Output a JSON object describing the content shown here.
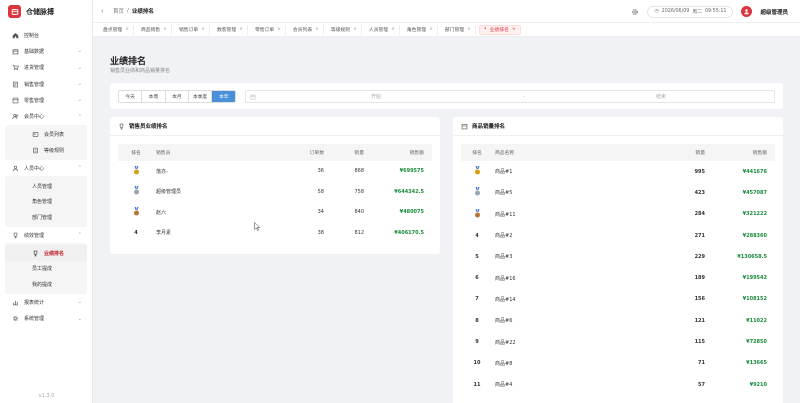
{
  "app": {
    "title": "仓储脉搏",
    "version": "v1.3.0"
  },
  "sidebar": {
    "items": [
      {
        "label": "控制台",
        "icon": "home-icon"
      },
      {
        "label": "基础数据",
        "icon": "box-icon"
      },
      {
        "label": "进货管理",
        "icon": "cart-icon"
      },
      {
        "label": "销售管理",
        "icon": "receipt-icon"
      },
      {
        "label": "零售管理",
        "icon": "store-icon"
      },
      {
        "label": "会员中心",
        "icon": "users-icon"
      }
    ],
    "member_sub": [
      {
        "label": "会员列表",
        "icon": "user-card-icon"
      },
      {
        "label": "等级规则",
        "icon": "badge-icon"
      }
    ],
    "hr": {
      "label": "人员中心",
      "icon": "person-icon"
    },
    "hr_sub": [
      {
        "label": "人员管理"
      },
      {
        "label": "角色管理"
      },
      {
        "label": "部门管理"
      }
    ],
    "perf": {
      "label": "绩效管理",
      "icon": "trophy-icon"
    },
    "perf_sub": [
      {
        "label": "业绩排名"
      },
      {
        "label": "员工提成"
      },
      {
        "label": "我的提成"
      }
    ],
    "bottom": [
      {
        "label": "报表统计",
        "icon": "chart-icon"
      },
      {
        "label": "系统管理",
        "icon": "gear-icon"
      }
    ]
  },
  "header": {
    "breadcrumb": [
      "首页",
      "业绩排名"
    ],
    "date": "2026/06/09",
    "weekday": "周二",
    "time": "09:55:11",
    "username": "超级管理员"
  },
  "tabs": [
    "盘点管理",
    "商品销售",
    "销售订单",
    "数客管理",
    "零售订单",
    "会员列表",
    "等级规则",
    "人员管理",
    "角色管理",
    "部门管理",
    "业绩排名"
  ],
  "page": {
    "title": "业绩排名",
    "subtitle": "销售员业绩和商品销量排名"
  },
  "filter": {
    "periods": [
      "今天",
      "本周",
      "本月",
      "本季度",
      "本年"
    ],
    "active_period": "本年",
    "start_placeholder": "开始",
    "separator": "-",
    "end_placeholder": "结束"
  },
  "sales_rank": {
    "title": "销售员业绩排名",
    "columns": [
      "排名",
      "销售员",
      "订单数",
      "销量",
      "销售额"
    ],
    "rows": [
      {
        "rank": "1",
        "name": "落亦-",
        "orders": "36",
        "qty": "868",
        "amount": "¥699575"
      },
      {
        "rank": "2",
        "name": "超级管理员",
        "orders": "58",
        "qty": "758",
        "amount": "¥644342.5"
      },
      {
        "rank": "3",
        "name": "赵六",
        "orders": "34",
        "qty": "840",
        "amount": "¥480075"
      },
      {
        "rank": "4",
        "name": "李月素",
        "orders": "38",
        "qty": "812",
        "amount": "¥406170.5"
      }
    ]
  },
  "product_rank": {
    "title": "商品销量排名",
    "columns": [
      "排名",
      "商品名称",
      "销量",
      "销售额"
    ],
    "rows": [
      {
        "rank": "1",
        "name": "商品#1",
        "qty": "995",
        "amount": "¥441676"
      },
      {
        "rank": "2",
        "name": "商品#5",
        "qty": "423",
        "amount": "¥457087"
      },
      {
        "rank": "3",
        "name": "商品#11",
        "qty": "284",
        "amount": "¥321222"
      },
      {
        "rank": "4",
        "name": "商品#2",
        "qty": "271",
        "amount": "¥288360"
      },
      {
        "rank": "5",
        "name": "商品#3",
        "qty": "229",
        "amount": "¥130658.5"
      },
      {
        "rank": "6",
        "name": "商品#16",
        "qty": "189",
        "amount": "¥199542"
      },
      {
        "rank": "7",
        "name": "商品#14",
        "qty": "156",
        "amount": "¥108152"
      },
      {
        "rank": "8",
        "name": "商品#6",
        "qty": "121",
        "amount": "¥11022"
      },
      {
        "rank": "9",
        "name": "商品#22",
        "qty": "115",
        "amount": "¥72850"
      },
      {
        "rank": "10",
        "name": "商品#8",
        "qty": "71",
        "amount": "¥13665"
      },
      {
        "rank": "11",
        "name": "商品#4",
        "qty": "57",
        "amount": "¥9210"
      }
    ]
  },
  "colors": {
    "brand": "#d9363e",
    "accent": "#4a90d9",
    "amount": "#1a8a3a",
    "gold": "#d4a017",
    "silver": "#9aa5b1",
    "bronze": "#b87333"
  }
}
